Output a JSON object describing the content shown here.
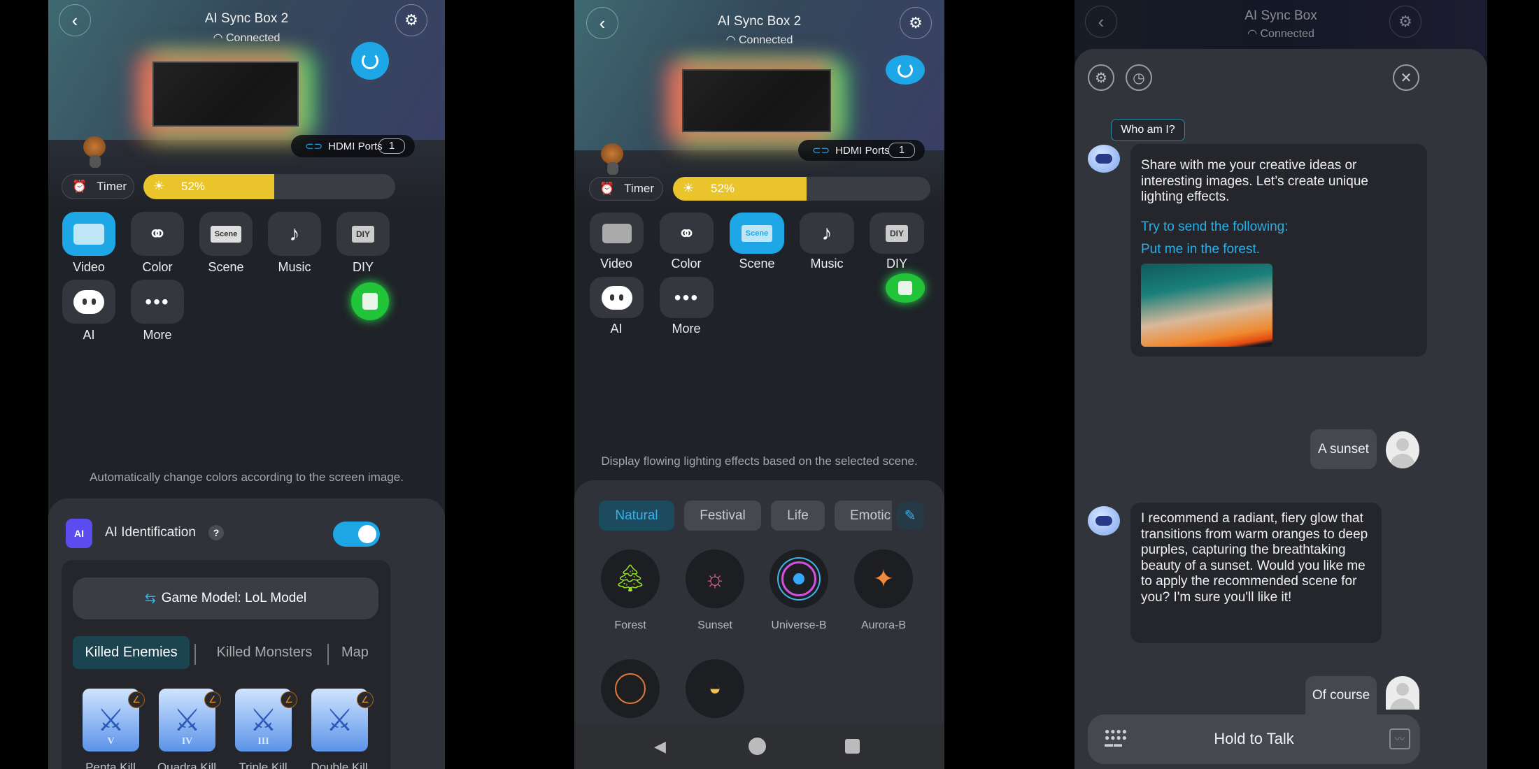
{
  "colors": {
    "accent": "#1ea7e6",
    "brightness": "#e9c42a",
    "green": "#22c43a",
    "ai_badge": "#5b4cf0"
  },
  "device": {
    "title_a": "AI Sync Box 2",
    "title_b": "AI Sync Box",
    "status": "Connected"
  },
  "hdmi": {
    "label": "HDMI Ports",
    "value": "1"
  },
  "timer": {
    "label": "Timer"
  },
  "brightness": {
    "percent": 52,
    "label": "52%"
  },
  "modes": [
    {
      "label": "Video",
      "icon": "video-icon"
    },
    {
      "label": "Color",
      "icon": "color-icon"
    },
    {
      "label": "Scene",
      "icon": "scene-icon"
    },
    {
      "label": "Music",
      "icon": "music-icon"
    },
    {
      "label": "DIY",
      "icon": "diy-icon"
    },
    {
      "label": "AI",
      "icon": "ai-robot-icon"
    },
    {
      "label": "More",
      "icon": "more-icon"
    }
  ],
  "panel1": {
    "description": "Automatically change colors according to the screen image.",
    "ai_identification": {
      "icon_text": "AI",
      "label": "AI Identification",
      "help": "?",
      "enabled": true
    },
    "game_model": "Game Model: LoL Model",
    "tabs": [
      "Killed Enemies",
      "Killed Monsters",
      "Map"
    ],
    "kills": [
      {
        "label": "Penta Kill",
        "numeral": "V"
      },
      {
        "label": "Quadra Kill",
        "numeral": "IV"
      },
      {
        "label": "Triple Kill",
        "numeral": "III"
      },
      {
        "label": "Double Kill",
        "numeral": ""
      }
    ]
  },
  "panel2": {
    "description": "Display flowing lighting effects based on the selected scene.",
    "categories": [
      "Natural",
      "Festival",
      "Life",
      "Emotic"
    ],
    "scenes": [
      "Forest",
      "Sunset",
      "Universe-B",
      "Aurora-B"
    ]
  },
  "panel3": {
    "who": "Who am I?",
    "intro": "Share with me your creative ideas or interesting images. Let’s create unique lighting effects.",
    "try": "Try to send the following:",
    "example": "Put me in the forest.",
    "user1": "A sunset",
    "reply": "I recommend a radiant, fiery glow that transitions from warm oranges to deep purples, capturing the breathtaking beauty of a sunset. Would you like me to apply the recommended scene for you? I'm sure you'll like it!",
    "user2": "Of course",
    "input": "Hold to Talk"
  }
}
